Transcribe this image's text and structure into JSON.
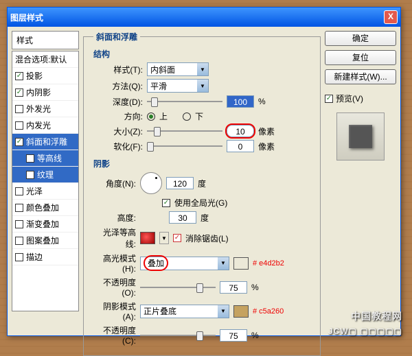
{
  "window": {
    "title": "图层样式",
    "close": "X"
  },
  "sidebar": {
    "head": "样式",
    "items": [
      {
        "label": "混合选项:默认",
        "checked": false,
        "cb": false
      },
      {
        "label": "投影",
        "checked": true
      },
      {
        "label": "内阴影",
        "checked": true
      },
      {
        "label": "外发光",
        "checked": false
      },
      {
        "label": "内发光",
        "checked": false
      },
      {
        "label": "斜面和浮雕",
        "checked": true,
        "selected": true
      },
      {
        "label": "等高线",
        "checked": false,
        "sub": true
      },
      {
        "label": "纹理",
        "checked": false,
        "sub": true
      },
      {
        "label": "光泽",
        "checked": false
      },
      {
        "label": "颜色叠加",
        "checked": false
      },
      {
        "label": "渐变叠加",
        "checked": false
      },
      {
        "label": "图案叠加",
        "checked": false
      },
      {
        "label": "描边",
        "checked": false
      }
    ]
  },
  "bevel": {
    "legend": "斜面和浮雕",
    "struct_legend": "结构",
    "style_label": "样式(T):",
    "style_value": "内斜面",
    "technique_label": "方法(Q):",
    "technique_value": "平滑",
    "depth_label": "深度(D):",
    "depth_value": "100",
    "depth_unit": "%",
    "dir_label": "方向:",
    "dir_up": "上",
    "dir_down": "下",
    "size_label": "大小(Z):",
    "size_value": "10",
    "size_unit": "像素",
    "soften_label": "软化(F):",
    "soften_value": "0",
    "soften_unit": "像素"
  },
  "shading": {
    "legend": "阴影",
    "angle_label": "角度(N):",
    "angle_value": "120",
    "angle_unit": "度",
    "global_label": "使用全局光(G)",
    "altitude_label": "高度:",
    "altitude_value": "30",
    "altitude_unit": "度",
    "gloss_label": "光泽等高线:",
    "antialias_label": "消除锯齿(L)",
    "highlight_mode_label": "高光模式(H):",
    "highlight_mode_value": "叠加",
    "highlight_color": "#e4d2b2",
    "highlight_annot": "# e4d2b2",
    "highlight_opacity_label": "不透明度(O):",
    "highlight_opacity_value": "75",
    "opacity_unit": "%",
    "shadow_mode_label": "阴影模式(A):",
    "shadow_mode_value": "正片叠底",
    "shadow_color": "#c5a260",
    "shadow_annot": "# c5a260",
    "shadow_opacity_label": "不透明度(C):",
    "shadow_opacity_value": "75"
  },
  "buttons": {
    "ok": "确定",
    "cancel": "复位",
    "newstyle": "新建样式(W)...",
    "preview_label": "预览(V)"
  },
  "watermark": {
    "cn": "中国教程网",
    "en": "JCW▢ ▢▢▢▢▢"
  }
}
